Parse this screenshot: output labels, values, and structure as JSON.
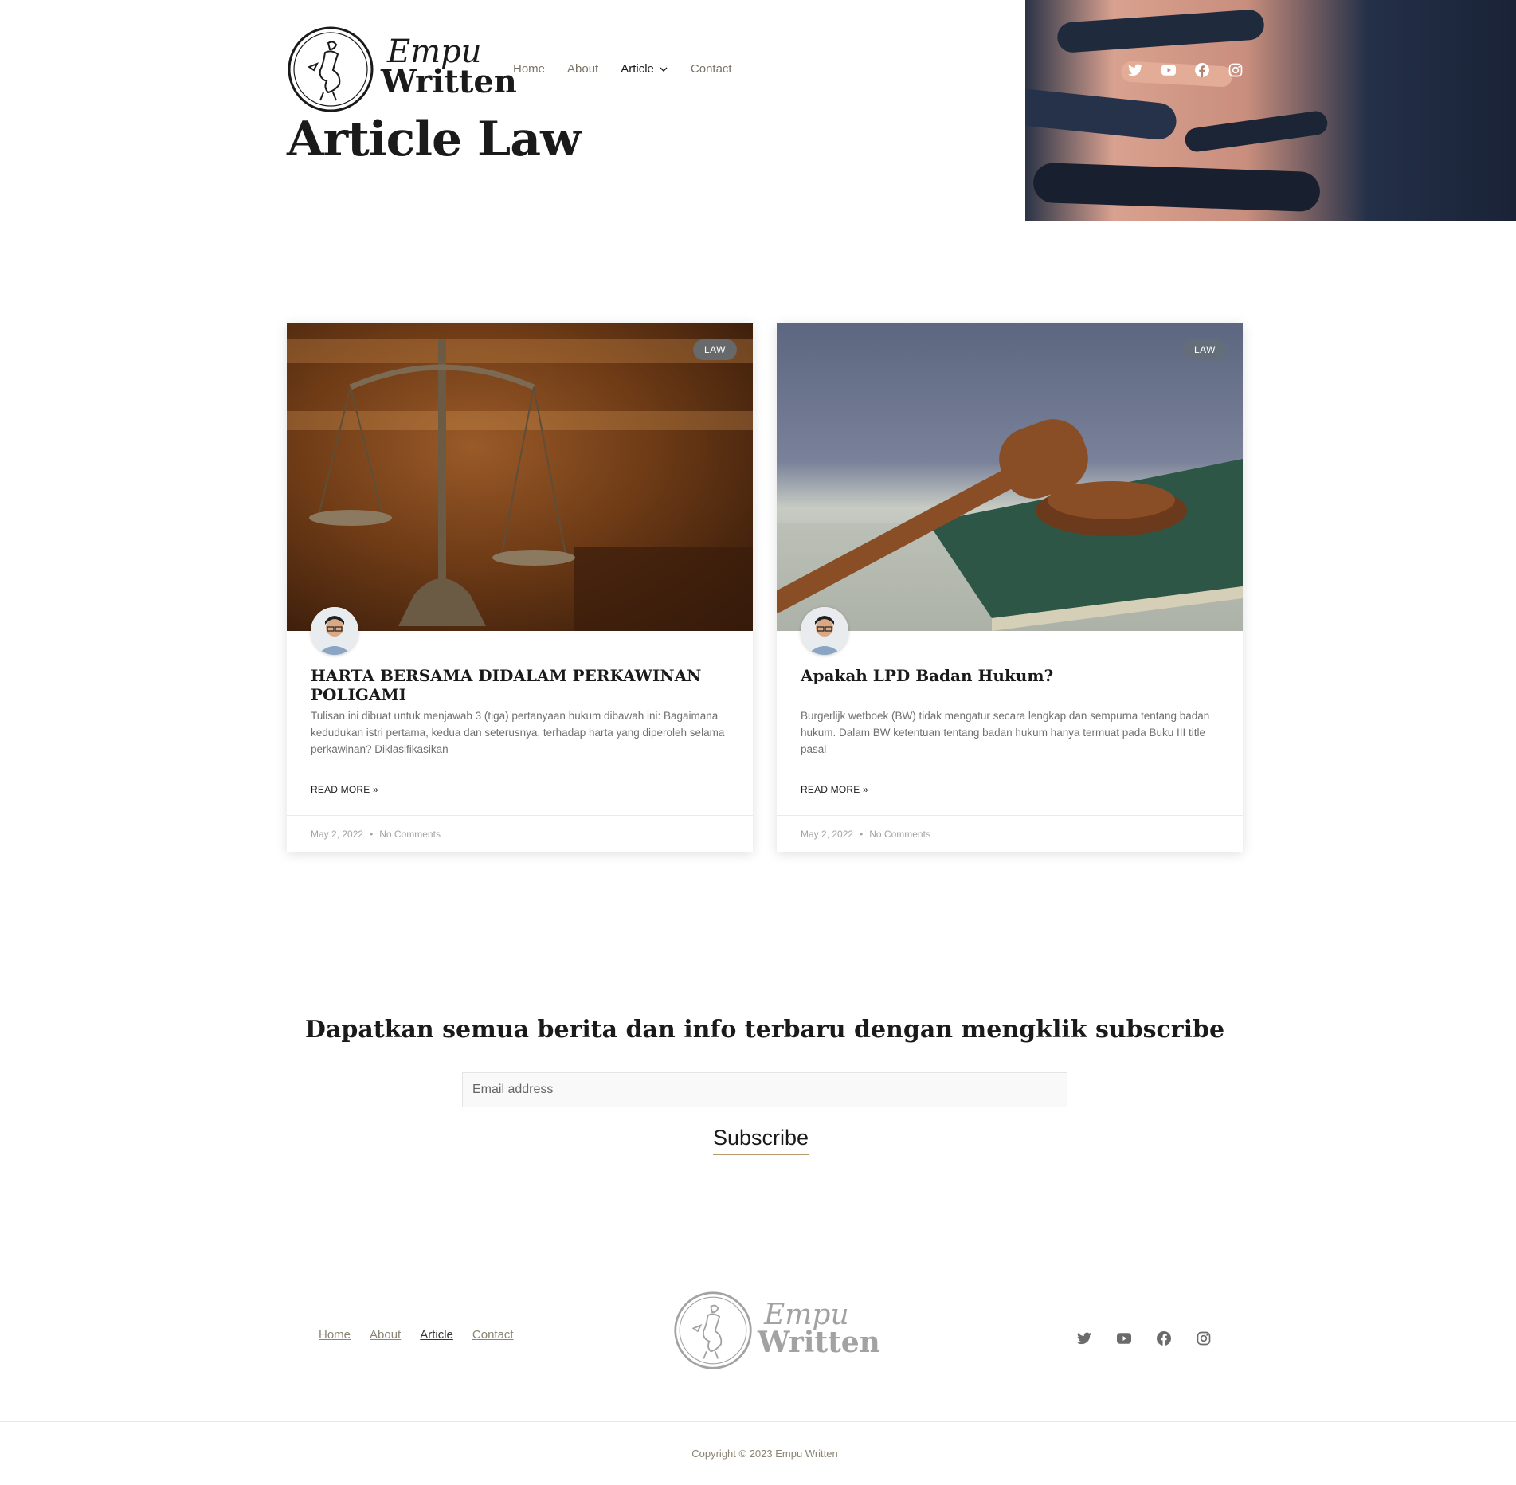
{
  "brand": {
    "line1": "Empu",
    "line2": "Written"
  },
  "nav": {
    "items": [
      {
        "label": "Home"
      },
      {
        "label": "About"
      },
      {
        "label": "Article"
      },
      {
        "label": "Contact"
      }
    ]
  },
  "social": [
    "twitter-icon",
    "youtube-icon",
    "facebook-icon",
    "instagram-icon"
  ],
  "page": {
    "title": "Article Law"
  },
  "articles": [
    {
      "category": "LAW",
      "title": "HARTA BERSAMA DIDALAM PERKAWINAN POLIGAMI",
      "excerpt": "Tulisan ini dibuat untuk menjawab 3 (tiga) pertanyaan hukum dibawah ini: Bagaimana kedudukan istri pertama, kedua dan seterusnya, terhadap harta yang diperoleh selama perkawinan? Diklasifikasikan",
      "read_more": "READ MORE »",
      "date": "May 2, 2022",
      "separator": "•",
      "comments": "No Comments"
    },
    {
      "category": "LAW",
      "title": "Apakah LPD Badan Hukum?",
      "excerpt": "Burgerlijk wetboek (BW) tidak mengatur secara lengkap dan sempurna tentang badan hukum. Dalam BW ketentuan tentang badan hukum hanya termuat pada Buku III title pasal",
      "read_more": "READ MORE »",
      "date": "May 2, 2022",
      "separator": "•",
      "comments": "No Comments"
    }
  ],
  "subscribe": {
    "heading": "Dapatkan semua berita dan info terbaru dengan mengklik subscribe",
    "email_placeholder": "Email address",
    "button_label": "Subscribe"
  },
  "footer": {
    "nav": [
      {
        "label": "Home"
      },
      {
        "label": "About"
      },
      {
        "label": "Article"
      },
      {
        "label": "Contact"
      }
    ],
    "copyright": "Copyright © 2023 Empu Written"
  },
  "colors": {
    "accent_underline": "#b89a6c",
    "text_dark": "#1a1a1a",
    "nav_muted": "#7a7465",
    "badge_bg": "#6e7680"
  }
}
